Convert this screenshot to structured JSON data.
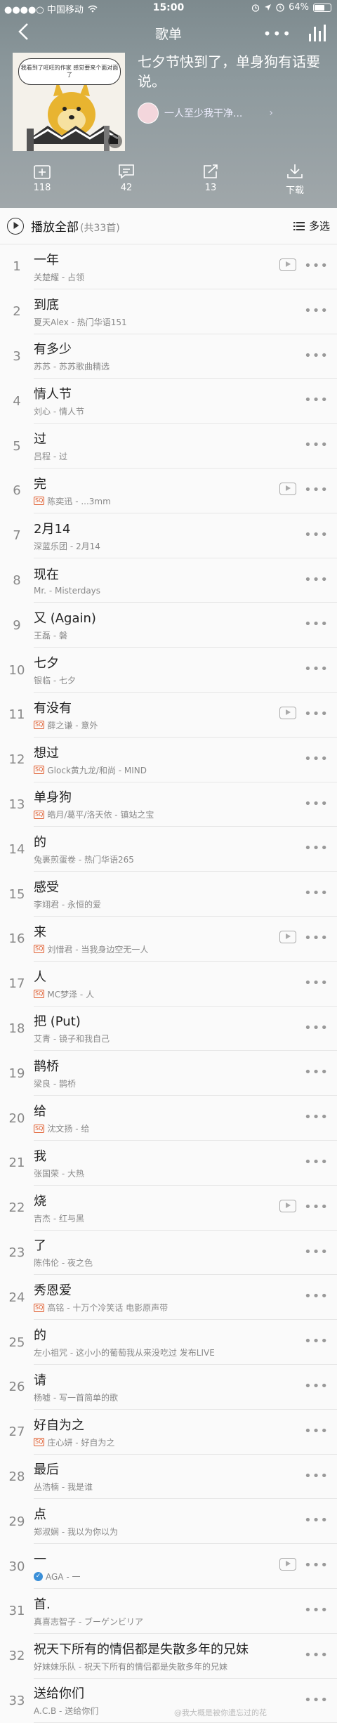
{
  "status_bar": {
    "carrier": "●●●●○ 中国移动",
    "time": "15:00",
    "battery": "64%",
    "battery_level": 0.64
  },
  "nav": {
    "title": "歌单"
  },
  "playlist": {
    "title": "七夕节快到了，单身狗有话要说。",
    "cover_text": "我看到了旺旺的作家 感觉要来个面对面了",
    "creator": "一人至少我干净..."
  },
  "actions": [
    {
      "label": "118",
      "icon": "add-folder-icon"
    },
    {
      "label": "42",
      "icon": "comment-icon"
    },
    {
      "label": "13",
      "icon": "share-icon"
    },
    {
      "label": "下载",
      "icon": "download-icon"
    }
  ],
  "play_all": {
    "label": "播放全部",
    "count": "(共33首)",
    "multi_select": "多选"
  },
  "songs": [
    {
      "index": "1",
      "title": "一年",
      "sub": "关楚耀 - 占领",
      "sq": false,
      "v": false,
      "mv": true
    },
    {
      "index": "2",
      "title": "到底",
      "sub": "夏天Alex - 热门华语151",
      "sq": false,
      "v": false,
      "mv": false
    },
    {
      "index": "3",
      "title": "有多少",
      "sub": "苏苏 - 苏苏歌曲精选",
      "sq": false,
      "v": false,
      "mv": false
    },
    {
      "index": "4",
      "title": "情人节",
      "sub": "刘心 - 情人节",
      "sq": false,
      "v": false,
      "mv": false
    },
    {
      "index": "5",
      "title": "过",
      "sub": "吕程 - 过",
      "sq": false,
      "v": false,
      "mv": false
    },
    {
      "index": "6",
      "title": "完",
      "sub": "陈奕迅 - ...3mm",
      "sq": true,
      "v": false,
      "mv": true
    },
    {
      "index": "7",
      "title": "2月14",
      "sub": "深蓝乐团 - 2月14",
      "sq": false,
      "v": false,
      "mv": false
    },
    {
      "index": "8",
      "title": "现在",
      "sub": "Mr. - Misterdays",
      "sq": false,
      "v": false,
      "mv": false
    },
    {
      "index": "9",
      "title": "又 (Again)",
      "sub": "王磊 - 磐",
      "sq": false,
      "v": false,
      "mv": false
    },
    {
      "index": "10",
      "title": "七夕",
      "sub": "银临 - 七夕",
      "sq": false,
      "v": false,
      "mv": false
    },
    {
      "index": "11",
      "title": "有没有",
      "sub": "薛之谦 - 意外",
      "sq": true,
      "v": false,
      "mv": true
    },
    {
      "index": "12",
      "title": "想过",
      "sub": "Glock黄九龙/和尚 - MIND",
      "sq": true,
      "v": false,
      "mv": false
    },
    {
      "index": "13",
      "title": "单身狗",
      "sub": "皓月/葛平/洛天依 - 镇站之宝",
      "sq": true,
      "v": false,
      "mv": false
    },
    {
      "index": "14",
      "title": "的",
      "sub": "兔裹煎蛋卷 - 热门华语265",
      "sq": false,
      "v": false,
      "mv": false
    },
    {
      "index": "15",
      "title": "感受",
      "sub": "李翊君 - 永恒的爱",
      "sq": false,
      "v": false,
      "mv": false
    },
    {
      "index": "16",
      "title": "来",
      "sub": "刘惜君 - 当我身边空无一人",
      "sq": true,
      "v": false,
      "mv": true
    },
    {
      "index": "17",
      "title": "人",
      "sub": "MC梦泽 - 人",
      "sq": true,
      "v": false,
      "mv": false
    },
    {
      "index": "18",
      "title": "把 (Put)",
      "sub": "艾青 - 镜子和我自己",
      "sq": false,
      "v": false,
      "mv": false
    },
    {
      "index": "19",
      "title": "鹊桥",
      "sub": "梁良 - 鹊桥",
      "sq": false,
      "v": false,
      "mv": false
    },
    {
      "index": "20",
      "title": "给",
      "sub": "沈文扬 - 给",
      "sq": true,
      "v": false,
      "mv": false
    },
    {
      "index": "21",
      "title": "我",
      "sub": "张国荣 - 大热",
      "sq": false,
      "v": false,
      "mv": false
    },
    {
      "index": "22",
      "title": "烧",
      "sub": "吉杰 - 红与黑",
      "sq": false,
      "v": false,
      "mv": true
    },
    {
      "index": "23",
      "title": "了",
      "sub": "陈伟伦 - 夜之色",
      "sq": false,
      "v": false,
      "mv": false
    },
    {
      "index": "24",
      "title": "秀恩爱",
      "sub": "高铭 - 十万个冷笑话 电影原声带",
      "sq": true,
      "v": false,
      "mv": false
    },
    {
      "index": "25",
      "title": "的",
      "sub": "左小祖咒 - 这小小的葡萄我从来没吃过 发布LIVE",
      "sq": false,
      "v": false,
      "mv": false
    },
    {
      "index": "26",
      "title": "请",
      "sub": "杨嘘 - 写一首简单的歌",
      "sq": false,
      "v": false,
      "mv": false
    },
    {
      "index": "27",
      "title": "好自为之",
      "sub": "庄心妍 - 好自为之",
      "sq": true,
      "v": false,
      "mv": false
    },
    {
      "index": "28",
      "title": "最后",
      "sub": "丛浩楠 - 我是谁",
      "sq": false,
      "v": false,
      "mv": false
    },
    {
      "index": "29",
      "title": "点",
      "sub": "郑淑娴 - 我以为你以为",
      "sq": false,
      "v": false,
      "mv": false
    },
    {
      "index": "30",
      "title": "一",
      "sub": "AGA - 一",
      "sq": false,
      "v": true,
      "mv": true
    },
    {
      "index": "31",
      "title": "首.",
      "sub": "真喜志智子 - ブーゲンビリア",
      "sq": false,
      "v": false,
      "mv": false
    },
    {
      "index": "32",
      "title": "祝天下所有的情侣都是失散多年的兄妹",
      "sub": "好妹妹乐队 - 祝天下所有的情侣都是失散多年的兄妹",
      "sq": false,
      "v": false,
      "mv": false
    },
    {
      "index": "33",
      "title": "送给你们",
      "sub": "A.C.B - 送给你们",
      "sq": false,
      "v": false,
      "mv": false
    }
  ],
  "watermark": "@我大概是被你遗忘过的花"
}
